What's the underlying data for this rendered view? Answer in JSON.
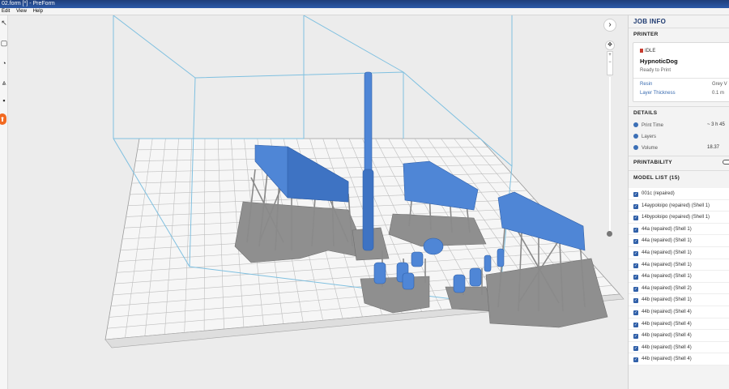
{
  "window": {
    "title": "02.form [*] - PreForm"
  },
  "menu": {
    "items": [
      "Edit",
      "View",
      "Help"
    ]
  },
  "toolbar": {
    "tools": [
      {
        "icon": "select-icon",
        "glyph": "↖"
      },
      {
        "icon": "cube-icon",
        "glyph": "▢"
      },
      {
        "icon": "orient-icon",
        "glyph": "◔"
      },
      {
        "icon": "supports-icon",
        "glyph": "⩓"
      },
      {
        "icon": "layout-icon",
        "glyph": "▪"
      },
      {
        "icon": "print-icon",
        "glyph": "⬆"
      }
    ]
  },
  "viewport": {
    "next_glyph": "›",
    "navcube_glyph": "✥",
    "zoom_in": "+",
    "zoom_out": "−",
    "model_color": "#4f86d6",
    "support_color": "#8f8f8f"
  },
  "panel": {
    "title": "JOB INFO",
    "printer_heading": "PRINTER",
    "printer": {
      "status": "IDLE",
      "name": "HypnoticDog",
      "subtitle": "Ready to Print",
      "resin_label": "Resin",
      "resin_value": "Grey V",
      "layer_label": "Layer Thickness",
      "layer_value": "0.1 m"
    },
    "details_heading": "DETAILS",
    "details": [
      {
        "icon": "clock-icon",
        "label": "Print Time",
        "value": "~ 3 h 45"
      },
      {
        "icon": "layers-icon",
        "label": "Layers",
        "value": ""
      },
      {
        "icon": "volume-icon",
        "label": "Volume",
        "value": "18.37"
      }
    ],
    "printability_heading": "PRINTABILITY",
    "model_list_heading": "MODEL LIST (15)",
    "models": [
      "001c (repaired)",
      "14aypoloipo (repaired) (Shell 1)",
      "14bypoloipo (repaired) (Shell 1)",
      "44a (repaired) (Shell 1)",
      "44a (repaired) (Shell 1)",
      "44a (repaired) (Shell 1)",
      "44a (repaired) (Shell 1)",
      "44a (repaired) (Shell 1)",
      "44a (repaired) (Shell 2)",
      "44b (repaired) (Shell 1)",
      "44b (repaired) (Shell 4)",
      "44b (repaired) (Shell 4)",
      "44b (repaired) (Shell 4)",
      "44b (repaired) (Shell 4)",
      "44b (repaired) (Shell 4)"
    ]
  }
}
